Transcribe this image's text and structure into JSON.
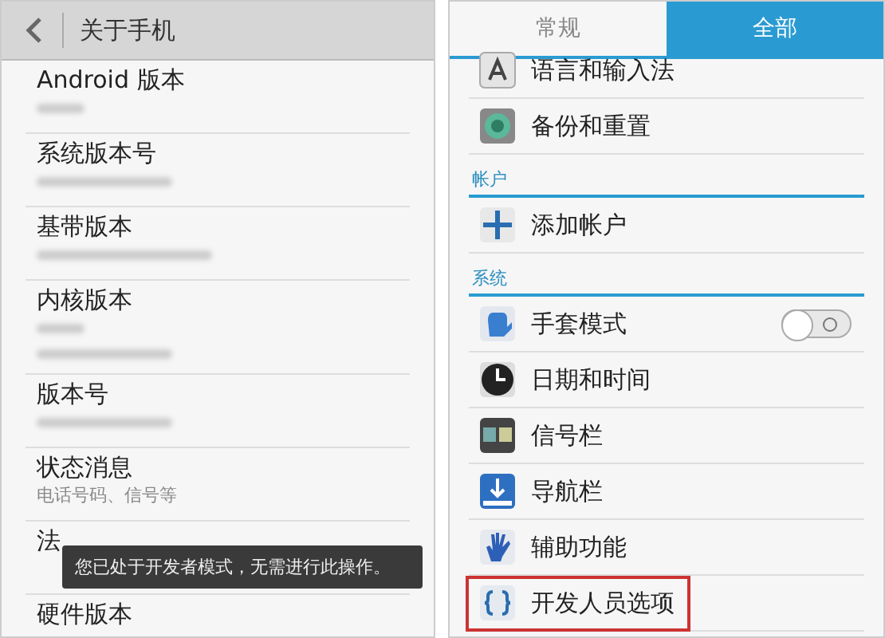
{
  "about_phone": {
    "title": "关于手机",
    "items": [
      {
        "label": "Android 版本",
        "sublines": [
          {
            "kind": "blurred"
          }
        ]
      },
      {
        "label": "系统版本号",
        "sublines": [
          {
            "kind": "blurred"
          }
        ]
      },
      {
        "label": "基带版本",
        "sublines": [
          {
            "kind": "blurred"
          }
        ]
      },
      {
        "label": "内核版本",
        "sublines": [
          {
            "kind": "blurred"
          },
          {
            "kind": "blurred"
          }
        ]
      },
      {
        "label": "版本号",
        "sublines": [
          {
            "kind": "blurred"
          }
        ]
      },
      {
        "label": "状态消息",
        "sublines": [
          {
            "kind": "text",
            "text": "电话号码、信号等"
          }
        ]
      },
      {
        "label": "法"
      },
      {
        "label": "硬件版本"
      }
    ],
    "toast": "您已处于开发者模式，无需进行此操作。"
  },
  "settings": {
    "tabs": [
      {
        "label": "常规",
        "selected": false
      },
      {
        "label": "全部",
        "selected": true
      }
    ],
    "rows": [
      {
        "kind": "language",
        "label": "语言和输入法"
      },
      {
        "kind": "backup",
        "label": "备份和重置"
      },
      {
        "kind": "section",
        "label": "帐户"
      },
      {
        "kind": "add",
        "label": "添加帐户"
      },
      {
        "kind": "section",
        "label": "系统"
      },
      {
        "kind": "glove",
        "label": "手套模式",
        "on": false
      },
      {
        "kind": "clock",
        "label": "日期和时间"
      },
      {
        "kind": "statusbar",
        "label": "信号栏"
      },
      {
        "kind": "navbar",
        "label": "导航栏"
      },
      {
        "kind": "hand",
        "label": "辅助功能"
      },
      {
        "kind": "braces",
        "label": "开发人员选项",
        "highlighted": true
      }
    ]
  }
}
